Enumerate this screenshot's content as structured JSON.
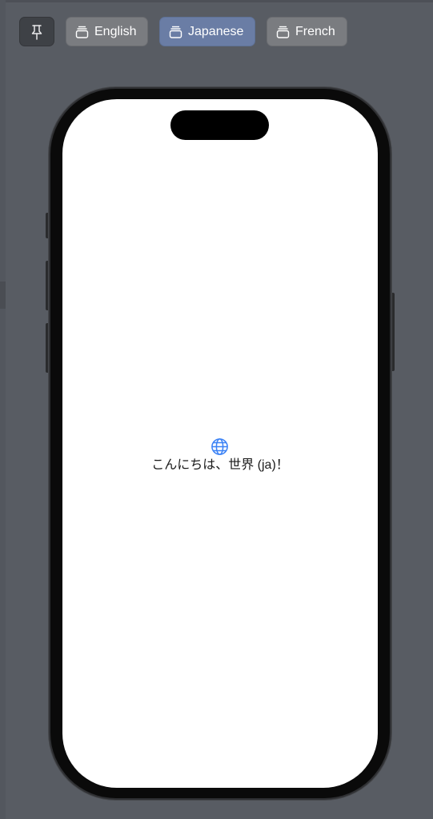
{
  "toolbar": {
    "pin_icon": "pin-icon",
    "tab_icon": "window-stack-icon",
    "tabs": [
      {
        "label": "English",
        "selected": false
      },
      {
        "label": "Japanese",
        "selected": true
      },
      {
        "label": "French",
        "selected": false
      }
    ],
    "selected_color": "#6a7da5"
  },
  "preview": {
    "device": "iPhone",
    "content": {
      "icon": "globe-icon",
      "icon_color": "#3b82f6",
      "greeting": "こんにちは、世界 (ja)！"
    }
  }
}
